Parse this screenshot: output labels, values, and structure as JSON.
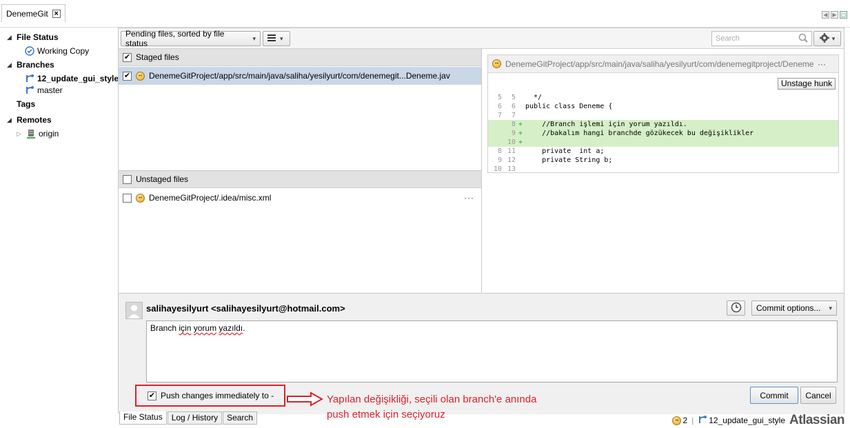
{
  "tab": {
    "title": "DenemeGit"
  },
  "sidebar": {
    "file_status": "File Status",
    "working_copy": "Working Copy",
    "branches": "Branches",
    "branch_items": [
      "12_update_gui_style",
      "master"
    ],
    "tags": "Tags",
    "remotes": "Remotes",
    "remote_items": [
      "origin"
    ]
  },
  "toolbar": {
    "sort_label": "Pending files, sorted by file status",
    "search_placeholder": "Search"
  },
  "staged": {
    "header": "Staged files",
    "files": [
      "DenemeGitProject/app/src/main/java/saliha/yesilyurt/com/denemegit...Deneme.jav"
    ]
  },
  "unstaged": {
    "header": "Unstaged files",
    "files": [
      "DenemeGitProject/.idea/misc.xml"
    ],
    "more": "···"
  },
  "diff": {
    "path": "DenemeGitProject/app/src/main/java/saliha/yesilyurt/com/denemegitproject/Deneme",
    "more": "···",
    "unstage_hunk": "Unstage hunk",
    "lines": [
      {
        "old": "5",
        "new": "5",
        "mark": "",
        "text": "  */",
        "type": "ctx"
      },
      {
        "old": "6",
        "new": "6",
        "mark": "",
        "text": "public class Deneme {",
        "type": "ctx"
      },
      {
        "old": "7",
        "new": "7",
        "mark": "",
        "text": "",
        "type": "ctx"
      },
      {
        "old": "",
        "new": "8",
        "mark": "+",
        "text": "    //Branch işlemi için yorum yazıldı.",
        "type": "add"
      },
      {
        "old": "",
        "new": "9",
        "mark": "+",
        "text": "    //bakalım hangi branchde gözükecek bu değişiklikler",
        "type": "add"
      },
      {
        "old": "",
        "new": "10",
        "mark": "+",
        "text": "",
        "type": "add"
      },
      {
        "old": "8",
        "new": "11",
        "mark": "",
        "text": "    private  int a;",
        "type": "ctx"
      },
      {
        "old": "9",
        "new": "12",
        "mark": "",
        "text": "    private String b;",
        "type": "ctx"
      },
      {
        "old": "10",
        "new": "13",
        "mark": "",
        "text": "",
        "type": "ctx"
      }
    ]
  },
  "commit": {
    "author": "salihayesilyurt <salihayesilyurt@hotmail.com>",
    "options_label": "Commit options...",
    "message_parts": [
      "Branch ",
      "için",
      " ",
      "yorum",
      " ",
      "yazıldı",
      "."
    ],
    "push_label": "Push changes immediately to -",
    "commit_button": "Commit",
    "cancel_button": "Cancel"
  },
  "bottom_tabs": [
    "File Status",
    "Log / History",
    "Search"
  ],
  "status": {
    "count": "2",
    "branch": "12_update_gui_style",
    "brand": "Atlassian"
  },
  "annotation": {
    "line1": "Yapılan değişikliği, seçili olan branch'e anında",
    "line2": "push etmek için seçiyoruz"
  },
  "colors": {
    "selected_row": "#c9d7e6",
    "added_line": "#d6efc8",
    "annotation_red": "#e0202a"
  }
}
